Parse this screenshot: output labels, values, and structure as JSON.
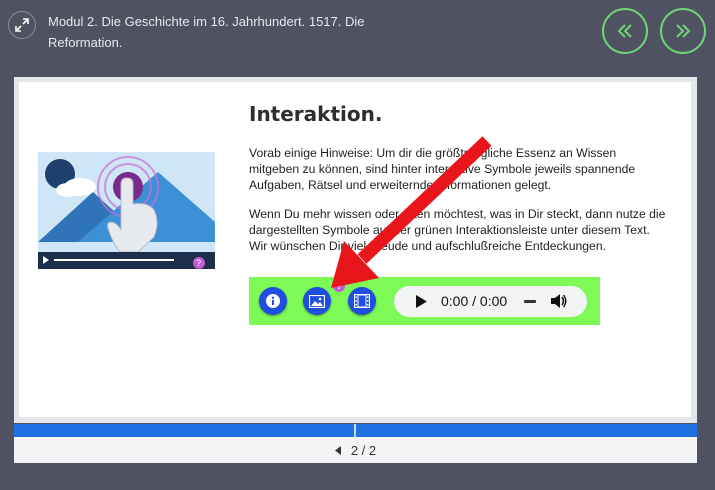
{
  "header": {
    "title": "Modul 2. Die Geschichte im 16. Jahrhundert. 1517. Die Reformation.",
    "expand_icon": "expand-icon",
    "prev_icon": "double-chevron-left-icon",
    "next_icon": "double-chevron-right-icon"
  },
  "slide": {
    "heading": "Interaktion.",
    "paragraph1": "Vorab einige Hinweise: Um dir die größtmögliche Essenz an Wissen mitgeben zu können, sind hinter interaktive Symbole jeweils spannende Aufgaben, Rätsel und erweiternde Informationen gelegt.",
    "paragraph2": "Wenn Du mehr wissen oder raten möchtest, was in Dir steckt, dann nutze die dargestellten Symbole auf der grünen Interaktionsleiste unter diesem Text. Wir wünschen Dir viel Freude und aufschlußreiche Entdeckungen.",
    "illustration_badge": "?"
  },
  "toolbar": {
    "badge": "?",
    "audio_time": "0:00 / 0:00"
  },
  "pager": {
    "text": "2 / 2"
  },
  "colors": {
    "background": "#4f5361",
    "accent_green": "#6fd37a",
    "toolbar_green": "#7dfa56",
    "button_blue": "#1e4fe0",
    "progress_blue": "#1e6fe0",
    "arrow_red": "#e8161b"
  }
}
